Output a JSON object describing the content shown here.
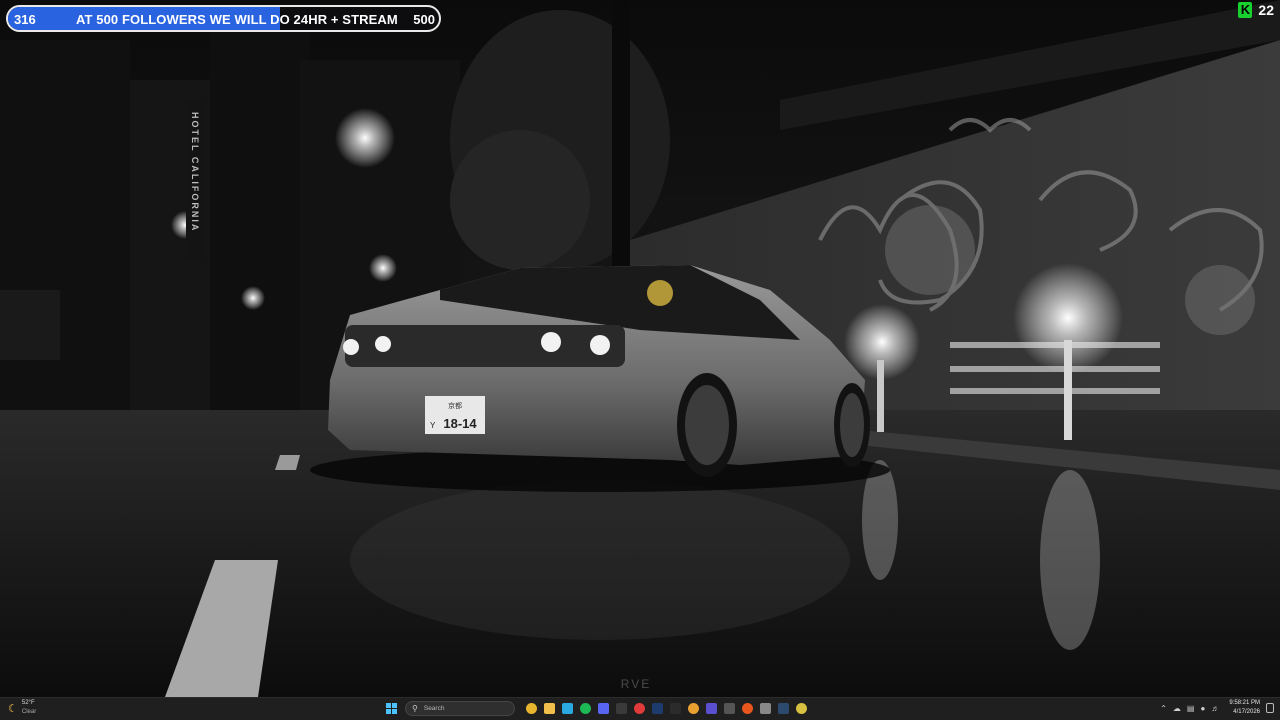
{
  "overlay": {
    "goal": {
      "current": "316",
      "label": "AT 500 FOLLOWERS WE WILL DO 24HR + STREAM",
      "target": "500",
      "progress_fraction": 0.632,
      "fill_color": "#2a63e0"
    },
    "kick": {
      "icon": "kick-logo-icon",
      "icon_letter": "K",
      "count": "22",
      "brand_color": "#18d12e"
    }
  },
  "wallpaper": {
    "sign_text": "HOTEL CALIFORNIA",
    "plate_top": "京都",
    "plate_main": "18-14",
    "plate_prefix": "Y",
    "watermark": "RVE"
  },
  "taskbar": {
    "weather": {
      "icon": "moon-icon",
      "temp": "52°F",
      "condition": "Clear"
    },
    "search_placeholder": "Search",
    "apps": [
      {
        "name": "chrome-icon",
        "color": "#e8b52f"
      },
      {
        "name": "file-explorer-icon",
        "color": "#f0c04a"
      },
      {
        "name": "edge-icon",
        "color": "#2aa8e0"
      },
      {
        "name": "spotify-icon",
        "color": "#1db954"
      },
      {
        "name": "discord-icon",
        "color": "#5865f2"
      },
      {
        "name": "obs-icon",
        "color": "#3a3a3a"
      },
      {
        "name": "adobe-icon",
        "color": "#e03a3a"
      },
      {
        "name": "photoshop-icon",
        "color": "#1e3b6e"
      },
      {
        "name": "terminal-icon",
        "color": "#2b2b2b"
      },
      {
        "name": "notes-icon",
        "color": "#e8a030"
      },
      {
        "name": "app-icon",
        "color": "#5a4fcf"
      },
      {
        "name": "headset-icon",
        "color": "#555555"
      },
      {
        "name": "brave-icon",
        "color": "#e8561e"
      },
      {
        "name": "settings-icon",
        "color": "#888888"
      },
      {
        "name": "steam-icon",
        "color": "#2b4a6e"
      },
      {
        "name": "game-icon",
        "color": "#d8c040"
      }
    ],
    "tray": {
      "chevron_icon": "chevron-up-icon",
      "icons": [
        "cloud-icon",
        "network-icon",
        "microphone-icon",
        "volume-icon"
      ],
      "time": "9:58:21 PM",
      "date": "4/17/2026"
    }
  }
}
